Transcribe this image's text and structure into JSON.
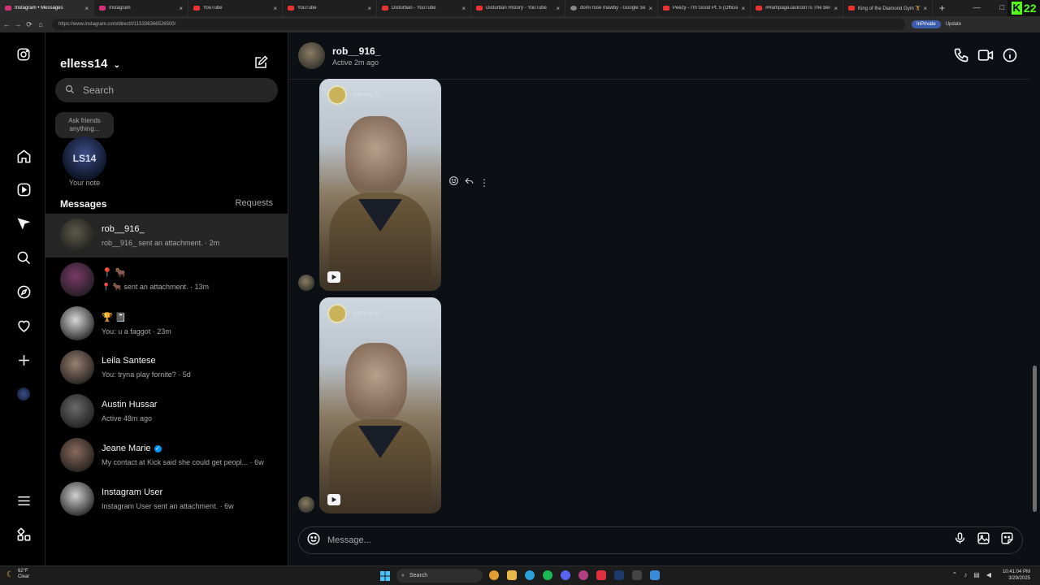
{
  "browser": {
    "tabs": [
      {
        "label": "Instagram • Messages",
        "active": true,
        "icon": "instagram"
      },
      {
        "label": "Instagram",
        "icon": "instagram"
      },
      {
        "label": "YouTube",
        "icon": "youtube"
      },
      {
        "label": "YouTube",
        "icon": "youtube"
      },
      {
        "label": "Disturban - YouTube",
        "icon": "youtube"
      },
      {
        "label": "Disturban History - YouTube",
        "icon": "youtube"
      },
      {
        "label": "domi rose mawby - Google Sear",
        "icon": "google"
      },
      {
        "label": "Peezy - I'm Good Pt. 5 (Official V",
        "icon": "youtube"
      },
      {
        "label": "#RampageJackson Is The Best H",
        "icon": "youtube"
      },
      {
        "label": "King of the Diamond Gym 🏋️ #g",
        "icon": "youtube"
      }
    ],
    "new_tab": "+",
    "url": "https://www.instagram.com/direct/t/115336366526500/",
    "inprivate": "InPrivate",
    "update": "Update",
    "kick_count": "22"
  },
  "inbox": {
    "username": "elless14",
    "search_placeholder": "Search",
    "note_bubble": "Ask friends anything...",
    "note_avatar_text": "LS14",
    "note_label": "Your note",
    "messages_heading": "Messages",
    "requests_label": "Requests",
    "conversations": [
      {
        "name": "rob__916_",
        "preview": "rob__916_ sent an attachment. · 2m",
        "selected": true,
        "avatar_color": "#5a5a4a"
      },
      {
        "name": "📍 🐂",
        "preview": "📍 🐂 sent an attachment. · 13m",
        "avatar_color": "#7a3a6a"
      },
      {
        "name": "🏆 📓",
        "preview": "You: u a faggot · 23m",
        "avatar_color": "#d8d8d8"
      },
      {
        "name": "Leila Santese",
        "preview": "You: tryna play fornite? · 5d",
        "avatar_color": "#9a8070"
      },
      {
        "name": "Austin Hussar",
        "preview": "Active 48m ago",
        "avatar_color": "#6a6a6a"
      },
      {
        "name": "Jeane Marie",
        "preview": "My contact at Kick said she could get peopl... · 6w",
        "verified": true,
        "avatar_color": "#8a6a5a"
      },
      {
        "name": "Instagram User",
        "preview": "Instagram User sent an attachment. · 6w",
        "avatar_color": "#d0d0d0"
      }
    ]
  },
  "chat": {
    "contact_name": "rob__916_",
    "contact_status": "Active 2m ago",
    "video_overlay_text": "kenny.lu",
    "composer_placeholder": "Message..."
  },
  "taskbar": {
    "weather_temp": "62°F",
    "weather_desc": "Clear",
    "search_label": "Search",
    "time": "10:41:04 PM",
    "date": "3/29/2025"
  }
}
